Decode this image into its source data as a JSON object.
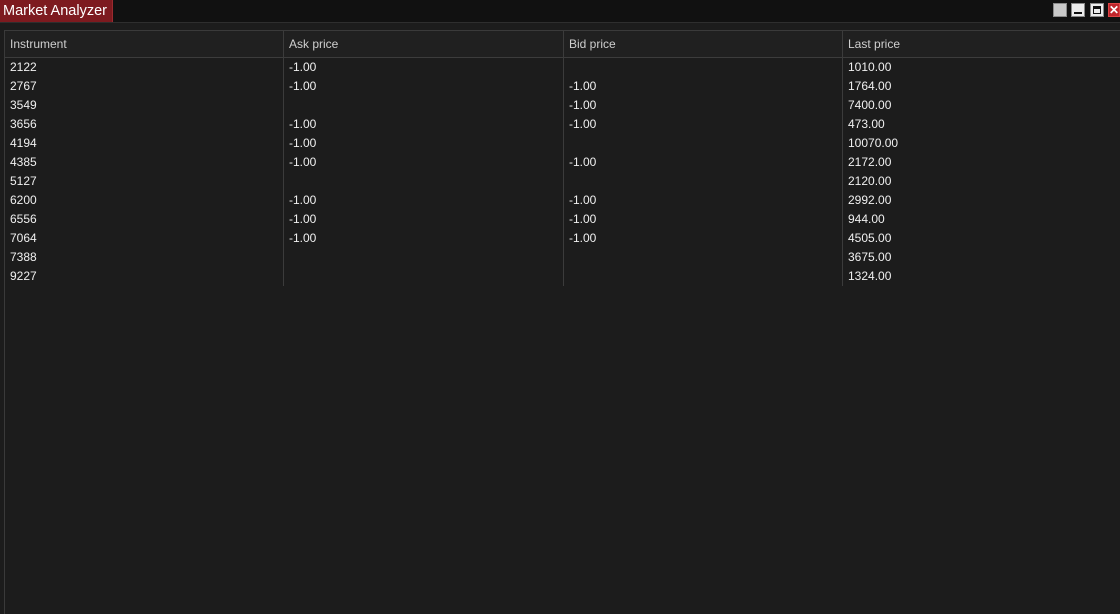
{
  "window": {
    "title": "Market Analyzer",
    "buttons": [
      {
        "name": "float-window-button",
        "glyph": ""
      },
      {
        "name": "minimize-button",
        "glyph": ""
      },
      {
        "name": "maximize-button",
        "glyph": ""
      },
      {
        "name": "close-button",
        "glyph": "✕"
      }
    ]
  },
  "table": {
    "columns": [
      "Instrument",
      "Ask price",
      "Bid price",
      "Last price"
    ],
    "rows": [
      [
        "2122",
        "-1.00",
        "",
        "1010.00"
      ],
      [
        "2767",
        "-1.00",
        "-1.00",
        "1764.00"
      ],
      [
        "3549",
        "",
        "-1.00",
        "7400.00"
      ],
      [
        "3656",
        "-1.00",
        "-1.00",
        "473.00"
      ],
      [
        "4194",
        "-1.00",
        "",
        "10070.00"
      ],
      [
        "4385",
        "-1.00",
        "-1.00",
        "2172.00"
      ],
      [
        "5127",
        "",
        "",
        "2120.00"
      ],
      [
        "6200",
        "-1.00",
        "-1.00",
        "2992.00"
      ],
      [
        "6556",
        "-1.00",
        "-1.00",
        "944.00"
      ],
      [
        "7064",
        "-1.00",
        "-1.00",
        "4505.00"
      ],
      [
        "7388",
        "",
        "",
        "3675.00"
      ],
      [
        "9227",
        "",
        "",
        "1324.00"
      ]
    ]
  },
  "colors": {
    "title_tab": "#7d1a1f",
    "background": "#1c1c1c",
    "text": "#f0f0f0",
    "grid_line": "#3b3b3b"
  }
}
